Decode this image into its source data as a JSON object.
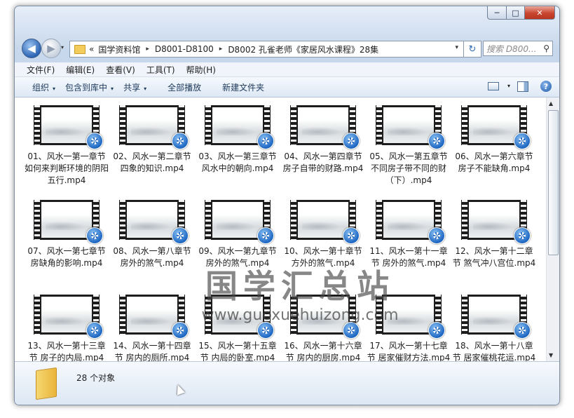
{
  "window": {
    "controls": {
      "minimize": "─",
      "maximize": "□",
      "close": "✕"
    }
  },
  "nav": {
    "back_glyph": "◀",
    "forward_glyph": "▶",
    "dropdown_glyph": "▾"
  },
  "address": {
    "prefix": "«",
    "crumbs": [
      "国学资料馆",
      "D8001-D8100",
      "D8002 孔雀老师《家居风水课程》28集"
    ],
    "separator": "▸",
    "dropdown_glyph": "▾",
    "refresh_glyph": "↻"
  },
  "search": {
    "placeholder": "搜索 D800...",
    "icon": "search-icon",
    "glyph": "⚲"
  },
  "menu": [
    "文件(F)",
    "编辑(E)",
    "查看(V)",
    "工具(T)",
    "帮助(H)"
  ],
  "commands": [
    {
      "label": "组织",
      "dropdown": true
    },
    {
      "label": "包含到库中",
      "dropdown": true
    },
    {
      "label": "共享",
      "dropdown": true
    },
    {
      "label": "全部播放",
      "dropdown": false
    },
    {
      "label": "新建文件夹",
      "dropdown": false
    }
  ],
  "caret_glyph": "▾",
  "help_glyph": "?",
  "files": [
    "01、风水一第一章节如何来判断环境的阴阳五行.mp4",
    "02、风水一第二章节 四象的知识.mp4",
    "03、风水一第三章节 风水中的朝向.mp4",
    "04、风水一第四章节 房子自带的财路.mp4",
    "05、风水一第五章节 不同房子带不同的财（下）.mp4",
    "06、风水一第六章节 房子不能缺角.mp4",
    "07、风水一第七章节 房缺角的影响.mp4",
    "08、风水一第八章节 房外的煞气.mp4",
    "09、风水一第九章节 房外的煞气.mp4",
    "10、风水一第十章节 方外的煞气.mp4",
    "11、风水一第十一章节 房外的煞气.mp4",
    "12、风水一第十二章节 煞气冲八宫位.mp4",
    "13、风水一第十三章节 房子的内局.mp4",
    "14、风水一第十四章节 房内的厕所.mp4",
    "15、风水一第十五章节 内局的卧室.mp4",
    "16、风水一第十六章节 房内的厨房.mp4",
    "17、风水一第十七章节 居家催财方法.mp4",
    "18、风水一第十八章节 居家催桃花运.mp4"
  ],
  "watermark": {
    "title": "国学汇总站",
    "url": "www.guoxuehuizong.com"
  },
  "status": {
    "count": "28 个对象"
  },
  "scroll": {
    "up": "▲",
    "down": "▼"
  }
}
